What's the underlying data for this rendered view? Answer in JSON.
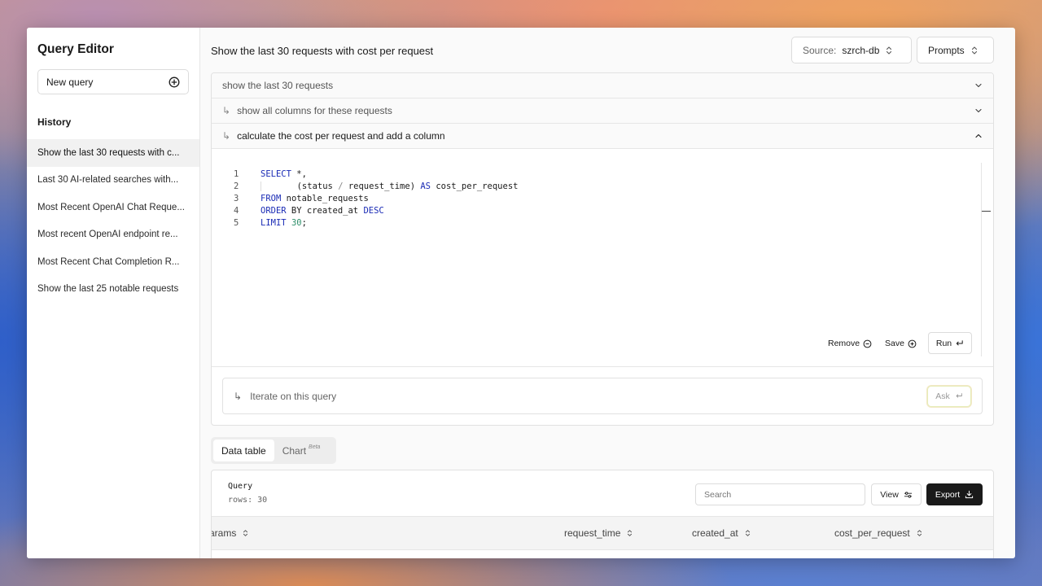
{
  "app": {
    "title": "Query Editor"
  },
  "sidebar": {
    "new_query_label": "New query",
    "history_heading": "History",
    "history": [
      "Show the last 30 requests with c...",
      "Last 30 AI-related searches with...",
      "Most Recent OpenAI Chat Reque...",
      "Most recent OpenAI endpoint re...",
      "Most Recent Chat Completion R...",
      "Show the last 25 notable requests"
    ]
  },
  "header": {
    "title": "Show the last 30 requests with cost per request",
    "source_label": "Source:",
    "source_value": "szrch-db",
    "prompts_label": "Prompts"
  },
  "prompts": [
    {
      "text": "show the last 30 requests",
      "arrow": ""
    },
    {
      "text": "show all columns for these requests",
      "arrow": "↳"
    },
    {
      "text": "calculate the cost per request and add a column",
      "arrow": "↳"
    }
  ],
  "editor": {
    "line_numbers": [
      "1",
      "2",
      "3",
      "4",
      "5"
    ],
    "code": {
      "l1_kw": "SELECT",
      "l1_rest": " *,",
      "l2_indent": "     (status ",
      "l2_op": "/",
      "l2_mid": " request_time) ",
      "l2_kw": "AS",
      "l2_rest": " cost_per_request",
      "l3_kw": "FROM",
      "l3_rest": " notable_requests",
      "l4_kw": "ORDER",
      "l4_mid": " BY created_at ",
      "l4_kw2": "DESC",
      "l5_kw": "LIMIT",
      "l5_num": "30",
      "l5_rest": ";"
    },
    "remove_label": "Remove",
    "save_label": "Save",
    "run_label": "Run"
  },
  "iterate": {
    "arrow": "↳",
    "placeholder": "Iterate on this query",
    "ask_label": "Ask"
  },
  "tabs": {
    "data_table": "Data table",
    "chart": "Chart",
    "chart_badge": "Beta"
  },
  "table": {
    "query_label": "Query",
    "rows_label": "rows: 30",
    "search_placeholder": "Search",
    "view_label": "View",
    "export_label": "Export",
    "columns": [
      "arams",
      "request_time",
      "created_at",
      "cost_per_request"
    ]
  },
  "colors": {
    "accent_dark": "#1a1a1a",
    "keyword": "#1a2bb5",
    "number": "#2f8f6b"
  }
}
